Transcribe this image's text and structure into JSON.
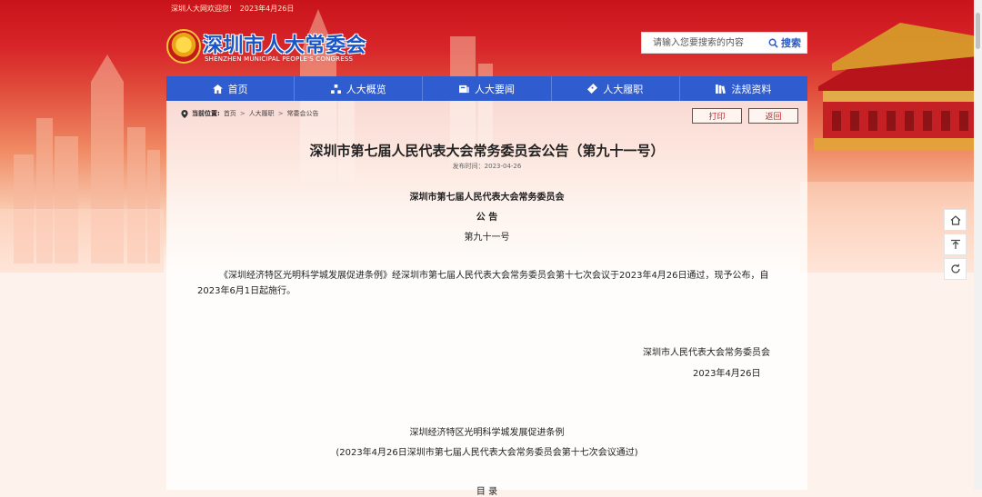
{
  "header": {
    "welcome": "深圳人大网欢迎您!",
    "date": "2023年4月26日",
    "logo_cn": "深圳市人大常委会",
    "logo_en": "SHENZHEN MUNICIPAL PEOPLE'S CONGRESS",
    "search_placeholder": "请输入您要搜索的内容",
    "search_button": "搜索"
  },
  "nav": {
    "items": [
      {
        "label": "首页",
        "icon": "home-icon"
      },
      {
        "label": "人大概览",
        "icon": "org-chart-icon"
      },
      {
        "label": "人大要闻",
        "icon": "news-icon"
      },
      {
        "label": "人大履职",
        "icon": "duty-icon"
      },
      {
        "label": "法规资料",
        "icon": "books-icon"
      }
    ]
  },
  "breadcrumb": {
    "label": "当前位置:",
    "items": [
      "首页",
      "人大履职",
      "常委会公告"
    ],
    "separator": ">"
  },
  "actions": {
    "print": "打印",
    "back": "返回"
  },
  "article": {
    "title": "深圳市第七届人民代表大会常务委员会公告（第九十一号）",
    "pubdate": "发布时间：2023-04-26",
    "org": "深圳市第七届人民代表大会常务委员会",
    "notice": "公 告",
    "number": "第九十一号",
    "body": "《深圳经济特区光明科学城发展促进条例》经深圳市第七届人民代表大会常务委员会第十七次会议于2023年4月26日通过，现予公布，自2023年6月1日起施行。",
    "sign_org": "深圳市人民代表大会常务委员会",
    "sign_date": "2023年4月26日",
    "law_title": "深圳经济特区光明科学城发展促进条例",
    "law_note": "(2023年4月26日深圳市第七届人民代表大会常务委员会第十七次会议通过)",
    "toc_cut": "目 录"
  },
  "side_tools": [
    "home-icon",
    "top-icon",
    "refresh-icon"
  ],
  "colors": {
    "brand_red": "#c8131a",
    "nav_blue": "#2f5dd0",
    "action_red": "#c8242a"
  }
}
